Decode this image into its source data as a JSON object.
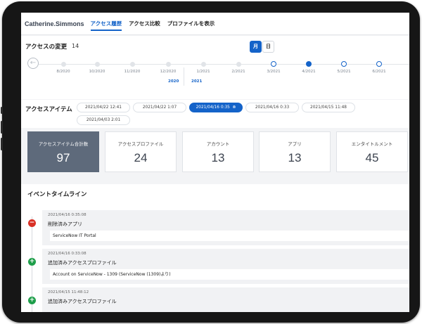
{
  "header": {
    "user_name": "Catherine.Simmons",
    "tabs": [
      {
        "label": "アクセス履歴",
        "active": true
      },
      {
        "label": "アクセス比較",
        "active": false
      },
      {
        "label": "プロファイルを表示",
        "active": false
      }
    ]
  },
  "changes": {
    "title": "アクセスの変更",
    "count": "14",
    "view_month": "月",
    "view_day": "日",
    "timeline": {
      "months": [
        "8/2020",
        "10/2020",
        "11/2020",
        "12/2020",
        "1/2021",
        "2/2021",
        "3/2021",
        "4/2021",
        "5/2021",
        "6/2021"
      ],
      "years": [
        "2020",
        "2021"
      ]
    }
  },
  "access_items": {
    "title": "アクセスアイテム",
    "dates": [
      {
        "label": "2021/04/22 12:41",
        "active": false
      },
      {
        "label": "2021/04/22 1:07",
        "active": false
      },
      {
        "label": "2021/04/16 0:35",
        "active": true
      },
      {
        "label": "2021/04/16 0:33",
        "active": false
      },
      {
        "label": "2021/04/15 11:48",
        "active": false
      },
      {
        "label": "2021/04/03 2:01",
        "active": false
      }
    ]
  },
  "stats": [
    {
      "label": "アクセスアイテム合計数",
      "value": "97"
    },
    {
      "label": "アクセスプロファイル",
      "value": "24"
    },
    {
      "label": "アカウント",
      "value": "13"
    },
    {
      "label": "アプリ",
      "value": "13"
    },
    {
      "label": "エンタイトルメント",
      "value": "45"
    }
  ],
  "events": {
    "title": "イベントタイムライン",
    "items": [
      {
        "time": "2021/04/16 0:35:08",
        "type": "削除済みアプリ",
        "detail": "ServiceNow IT Portal",
        "kind": "remove"
      },
      {
        "time": "2021/04/16 0:33:08",
        "type": "追加済みアクセスプロファイル",
        "detail": "Account on ServiceNow - 1309 (ServiceNow (1309)より)",
        "kind": "add"
      },
      {
        "time": "2021/04/15 11:48:12",
        "type": "追加済みアクセスプロファイル",
        "detail": "",
        "kind": "add"
      }
    ]
  },
  "colors": {
    "accent": "#1463c9",
    "stat_primary": "#5e6a7b",
    "remove": "#d93025",
    "add": "#1e9e4a"
  }
}
